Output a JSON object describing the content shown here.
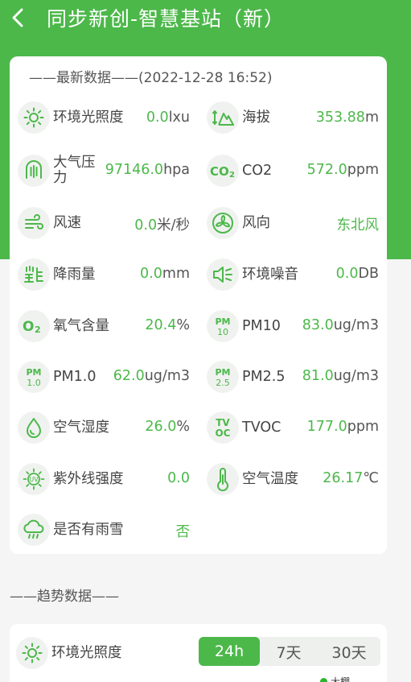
{
  "header": {
    "title": "同步新创-智慧基站（新）"
  },
  "latest": {
    "heading": "——最新数据——(2022-12-28 16:52)",
    "items": [
      {
        "label": "环境光照度",
        "value": "0.0",
        "unit": "lxu"
      },
      {
        "label": "海拔",
        "value": "353.88",
        "unit": "m"
      },
      {
        "label": "大气压力",
        "value": "97146.0",
        "unit": "hpa"
      },
      {
        "label": "CO2",
        "value": "572.0",
        "unit": "ppm"
      },
      {
        "label": "风速",
        "value": "0.0",
        "unit": "米/秒"
      },
      {
        "label": "风向",
        "value": "东北风",
        "unit": ""
      },
      {
        "label": "降雨量",
        "value": "0.0",
        "unit": "mm"
      },
      {
        "label": "环境噪音",
        "value": "0.0",
        "unit": "DB"
      },
      {
        "label": "氧气含量",
        "value": "20.4",
        "unit": "%"
      },
      {
        "label": "PM10",
        "value": "83.0",
        "unit": "ug/m3"
      },
      {
        "label": "PM1.0",
        "value": "62.0",
        "unit": "ug/m3"
      },
      {
        "label": "PM2.5",
        "value": "81.0",
        "unit": "ug/m3"
      },
      {
        "label": "空气湿度",
        "value": "26.0",
        "unit": "%"
      },
      {
        "label": "TVOC",
        "value": "177.0",
        "unit": "ppm"
      },
      {
        "label": "紫外线强度",
        "value": "0.0",
        "unit": ""
      },
      {
        "label": "空气温度",
        "value": "26.17",
        "unit": "℃"
      },
      {
        "label": "是否有雨雪",
        "value": "否",
        "unit": ""
      }
    ]
  },
  "trend": {
    "heading": "——趋势数据——",
    "metric_label": "环境光照度",
    "ranges": [
      "24h",
      "7天",
      "30天"
    ],
    "active_range": "24h",
    "legend_label": "大棚"
  },
  "colors": {
    "accent": "#4cb84a",
    "legend_dot": "#2bb52b"
  }
}
